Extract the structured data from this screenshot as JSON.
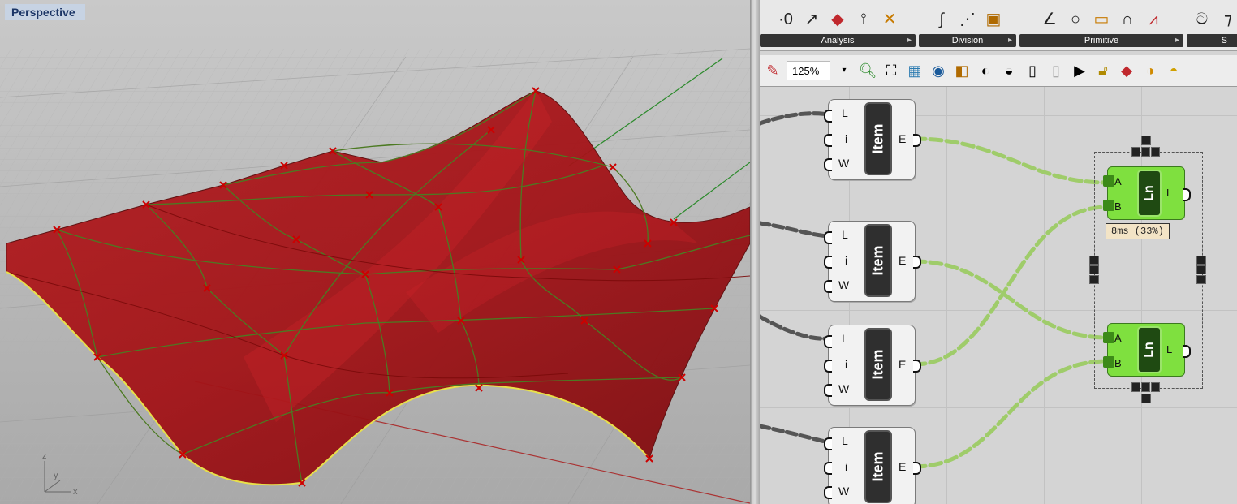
{
  "viewport": {
    "label": "Perspective",
    "axes": {
      "z": "z",
      "y": "y",
      "x": "x"
    }
  },
  "ribbon": {
    "groups": [
      {
        "label": "Analysis",
        "icons": [
          "evaluate-curve-icon",
          "curve-length-icon",
          "curve-closest-point-icon",
          "curve-frames-icon",
          "curve-param-icon"
        ]
      },
      {
        "label": "Division",
        "icons": [
          "divide-curve-icon",
          "divide-distance-icon",
          "shatter-icon"
        ]
      },
      {
        "label": "Primitive",
        "icons": [
          "line-icon",
          "circle-icon",
          "rectangle-icon",
          "arc-icon",
          "polyline-icon"
        ]
      },
      {
        "label": "S",
        "icons": [
          "spline-icon",
          "interpolate-icon"
        ]
      }
    ]
  },
  "toolbar": {
    "zoom": "125%"
  },
  "canvas": {
    "item_nodes": [
      {
        "title": "Item",
        "inputs": [
          "L",
          "i",
          "W"
        ],
        "output": "E"
      },
      {
        "title": "Item",
        "inputs": [
          "L",
          "i",
          "W"
        ],
        "output": "E"
      },
      {
        "title": "Item",
        "inputs": [
          "L",
          "i",
          "W"
        ],
        "output": "E"
      },
      {
        "title": "Item",
        "inputs": [
          "L",
          "i",
          "W"
        ],
        "output": "E"
      }
    ],
    "line_nodes": [
      {
        "title": "Ln",
        "inputs": [
          "A",
          "B"
        ],
        "output": "L"
      },
      {
        "title": "Ln",
        "inputs": [
          "A",
          "B"
        ],
        "output": "L"
      }
    ],
    "profiler": "8ms (33%)"
  },
  "colors": {
    "surface": "#a31418",
    "isocurve": "#4c7a22",
    "edge": "#e8e04a",
    "selected_component": "#7fe03f",
    "wire": "#9fcc6a"
  }
}
